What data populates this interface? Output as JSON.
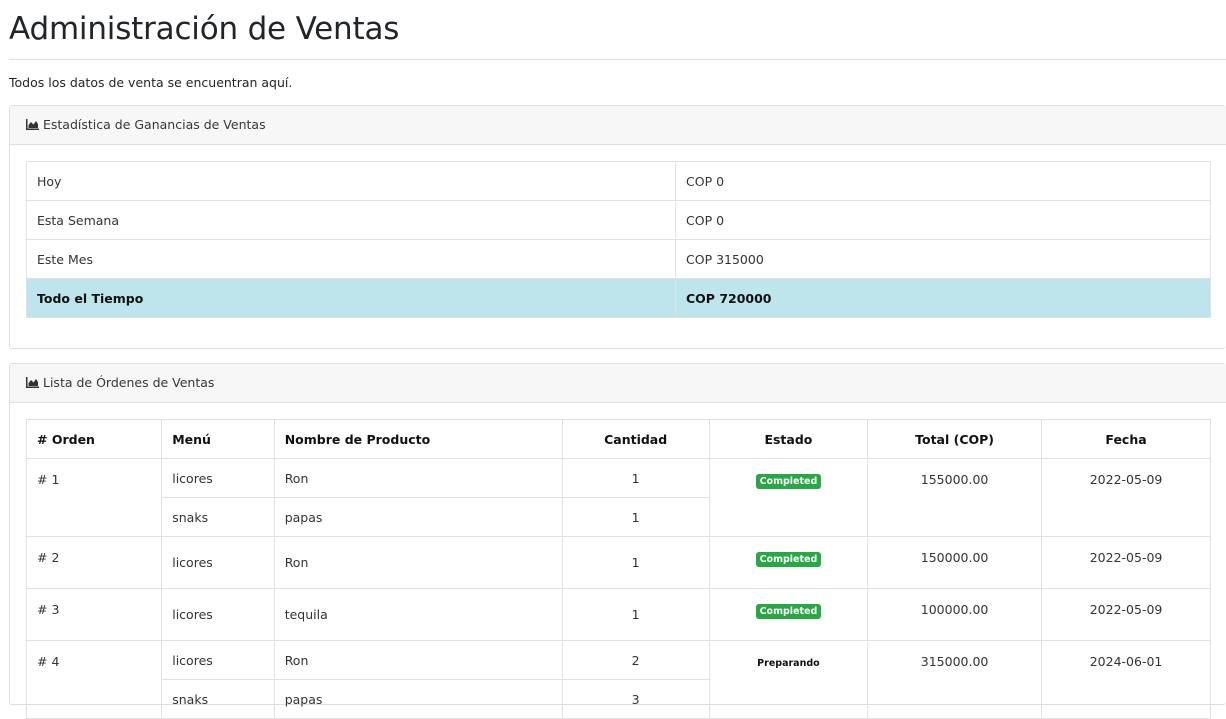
{
  "page": {
    "title": "Administración de Ventas",
    "subtitle": "Todos los datos de venta se encuentran aquí."
  },
  "stats_card": {
    "header": "Estadística de Ganancias de Ventas",
    "icon": "area-chart-icon",
    "rows": [
      {
        "label": "Hoy",
        "value": "COP 0"
      },
      {
        "label": "Esta Semana",
        "value": "COP 0"
      },
      {
        "label": "Este Mes",
        "value": "COP 315000"
      },
      {
        "label": "Todo el Tiempo",
        "value": "COP 720000"
      }
    ]
  },
  "orders_card": {
    "header": "Lista de Órdenes de Ventas",
    "icon": "area-chart-icon",
    "columns": [
      "# Orden",
      "Menú",
      "Nombre de Producto",
      "Cantidad",
      "Estado",
      "Total (COP)",
      "Fecha"
    ],
    "orders": [
      {
        "order": "# 1",
        "status": "Completed",
        "status_style": "badge",
        "total": "155000.00",
        "date": "2022-05-09",
        "items": [
          {
            "menu": "licores",
            "product": "Ron",
            "qty": "1"
          },
          {
            "menu": "snaks",
            "product": "papas",
            "qty": "1"
          }
        ]
      },
      {
        "order": "# 2",
        "status": "Completed",
        "status_style": "badge",
        "total": "150000.00",
        "date": "2022-05-09",
        "items": [
          {
            "menu": "licores",
            "product": "Ron",
            "qty": "1"
          }
        ]
      },
      {
        "order": "# 3",
        "status": "Completed",
        "status_style": "badge",
        "total": "100000.00",
        "date": "2022-05-09",
        "items": [
          {
            "menu": "licores",
            "product": "tequila",
            "qty": "1"
          }
        ]
      },
      {
        "order": "# 4",
        "status": "Preparando",
        "status_style": "plain",
        "total": "315000.00",
        "date": "2024-06-01",
        "items": [
          {
            "menu": "licores",
            "product": "Ron",
            "qty": "2"
          },
          {
            "menu": "snaks",
            "product": "papas",
            "qty": "3"
          }
        ]
      }
    ]
  },
  "colors": {
    "badge_success": "#28a745",
    "highlight_row": "#bee5eb",
    "card_header_bg": "#f7f7f7"
  }
}
